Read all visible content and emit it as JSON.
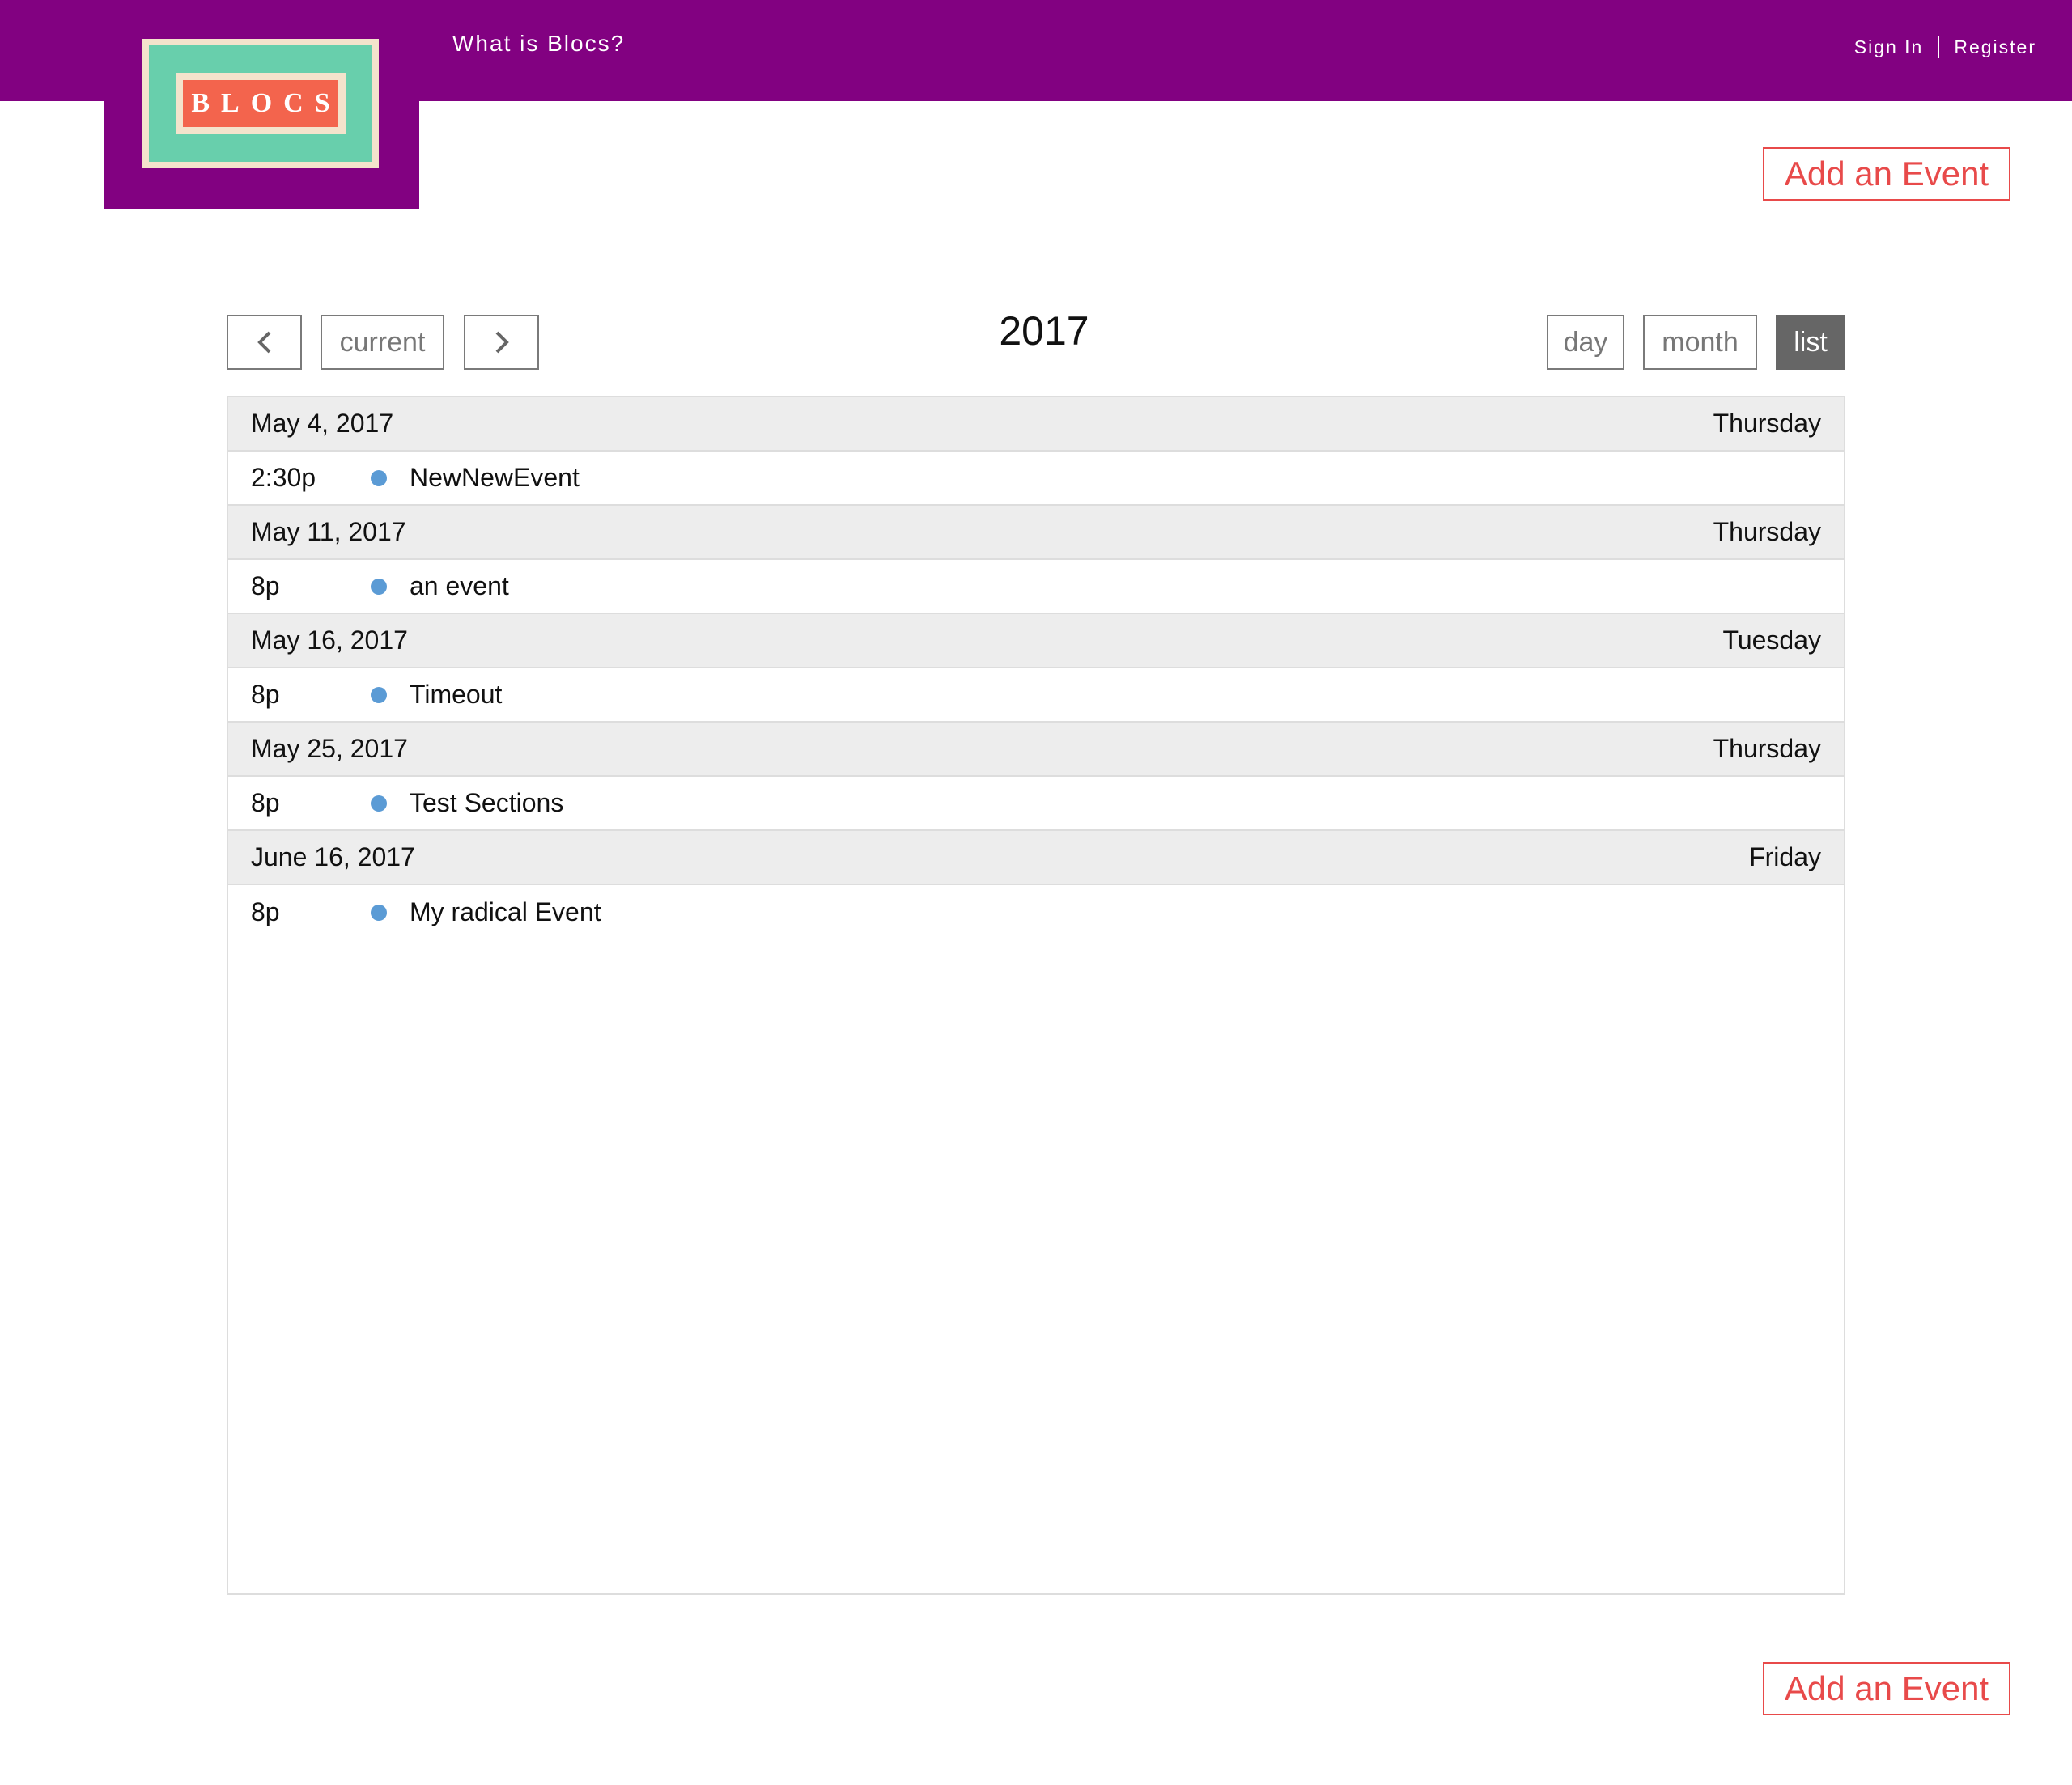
{
  "header": {
    "logo_text": "BLOCS",
    "nav_what": "What is Blocs?",
    "sign_in": "Sign In",
    "register": "Register"
  },
  "actions": {
    "add_event_top": "Add an Event",
    "add_event_bottom": "Add an Event"
  },
  "calendar": {
    "title": "2017",
    "toolbar": {
      "prev_icon": "chevron-left-icon",
      "current": "current",
      "next_icon": "chevron-right-icon",
      "views": [
        "day",
        "month",
        "list"
      ],
      "active_view": "list"
    },
    "days": [
      {
        "date": "May 4, 2017",
        "weekday": "Thursday",
        "events": [
          {
            "time": "2:30p",
            "title": "NewNewEvent"
          }
        ]
      },
      {
        "date": "May 11, 2017",
        "weekday": "Thursday",
        "events": [
          {
            "time": "8p",
            "title": "an event"
          }
        ]
      },
      {
        "date": "May 16, 2017",
        "weekday": "Tuesday",
        "events": [
          {
            "time": "8p",
            "title": "Timeout"
          }
        ]
      },
      {
        "date": "May 25, 2017",
        "weekday": "Thursday",
        "events": [
          {
            "time": "8p",
            "title": "Test Sections"
          }
        ]
      },
      {
        "date": "June 16, 2017",
        "weekday": "Friday",
        "events": [
          {
            "time": "8p",
            "title": "My radical Event"
          }
        ]
      }
    ]
  },
  "colors": {
    "brand_purple": "#820181",
    "accent_red": "#e84a4a",
    "event_dot": "#5b9bd5",
    "active_view_bg": "#666666"
  }
}
